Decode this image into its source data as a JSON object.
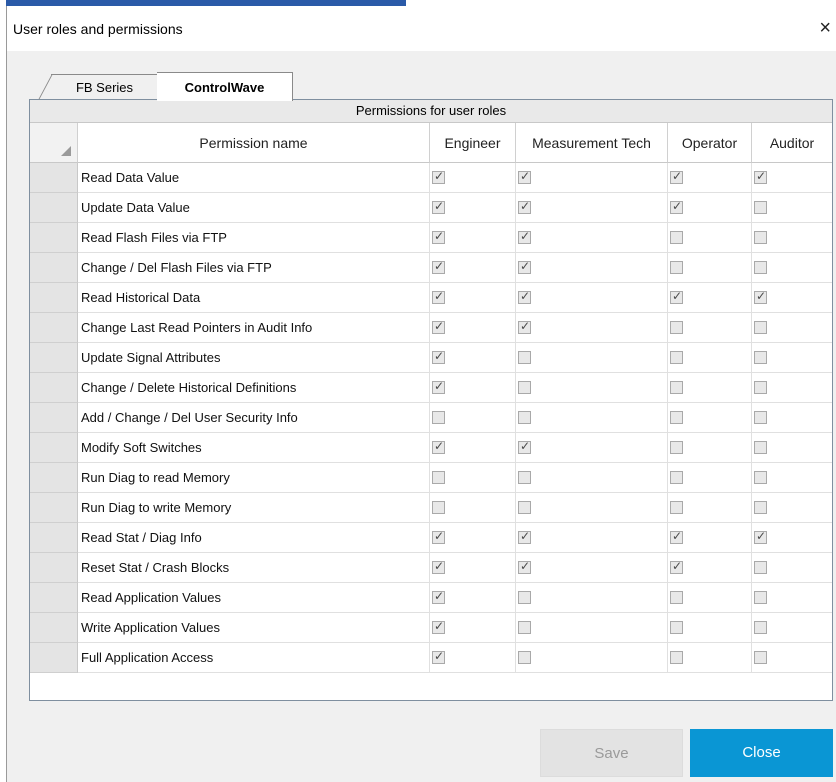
{
  "window": {
    "title": "User roles and permissions",
    "close_glyph": "×"
  },
  "tabs": [
    {
      "label": "FB Series",
      "active": false
    },
    {
      "label": "ControlWave",
      "active": true
    }
  ],
  "grid": {
    "caption": "Permissions for user roles",
    "columns": [
      "Permission name",
      "Engineer",
      "Measurement Tech",
      "Operator",
      "Auditor"
    ],
    "rows": [
      {
        "name": "Read Data Value",
        "checks": [
          true,
          true,
          true,
          true
        ]
      },
      {
        "name": "Update Data Value",
        "checks": [
          true,
          true,
          true,
          false
        ]
      },
      {
        "name": "Read Flash Files via FTP",
        "checks": [
          true,
          true,
          false,
          false
        ]
      },
      {
        "name": "Change / Del Flash Files via FTP",
        "checks": [
          true,
          true,
          false,
          false
        ]
      },
      {
        "name": "Read Historical Data",
        "checks": [
          true,
          true,
          true,
          true
        ]
      },
      {
        "name": "Change Last Read Pointers in Audit Info",
        "checks": [
          true,
          true,
          false,
          false
        ]
      },
      {
        "name": "Update Signal Attributes",
        "checks": [
          true,
          false,
          false,
          false
        ]
      },
      {
        "name": "Change / Delete Historical Definitions",
        "checks": [
          true,
          false,
          false,
          false
        ]
      },
      {
        "name": "Add / Change / Del User Security Info",
        "checks": [
          false,
          false,
          false,
          false
        ]
      },
      {
        "name": "Modify Soft Switches",
        "checks": [
          true,
          true,
          false,
          false
        ]
      },
      {
        "name": "Run Diag to read Memory",
        "checks": [
          false,
          false,
          false,
          false
        ]
      },
      {
        "name": "Run Diag to write Memory",
        "checks": [
          false,
          false,
          false,
          false
        ]
      },
      {
        "name": "Read Stat / Diag Info",
        "checks": [
          true,
          true,
          true,
          true
        ]
      },
      {
        "name": "Reset Stat / Crash Blocks",
        "checks": [
          true,
          true,
          true,
          false
        ]
      },
      {
        "name": "Read Application Values",
        "checks": [
          true,
          false,
          false,
          false
        ]
      },
      {
        "name": "Write Application Values",
        "checks": [
          true,
          false,
          false,
          false
        ]
      },
      {
        "name": "Full Application Access",
        "checks": [
          true,
          false,
          false,
          false
        ]
      }
    ]
  },
  "buttons": {
    "save": "Save",
    "close": "Close",
    "save_enabled": false
  },
  "colors": {
    "accent": "#0a96d4",
    "disabled": "#e3e3e3"
  }
}
